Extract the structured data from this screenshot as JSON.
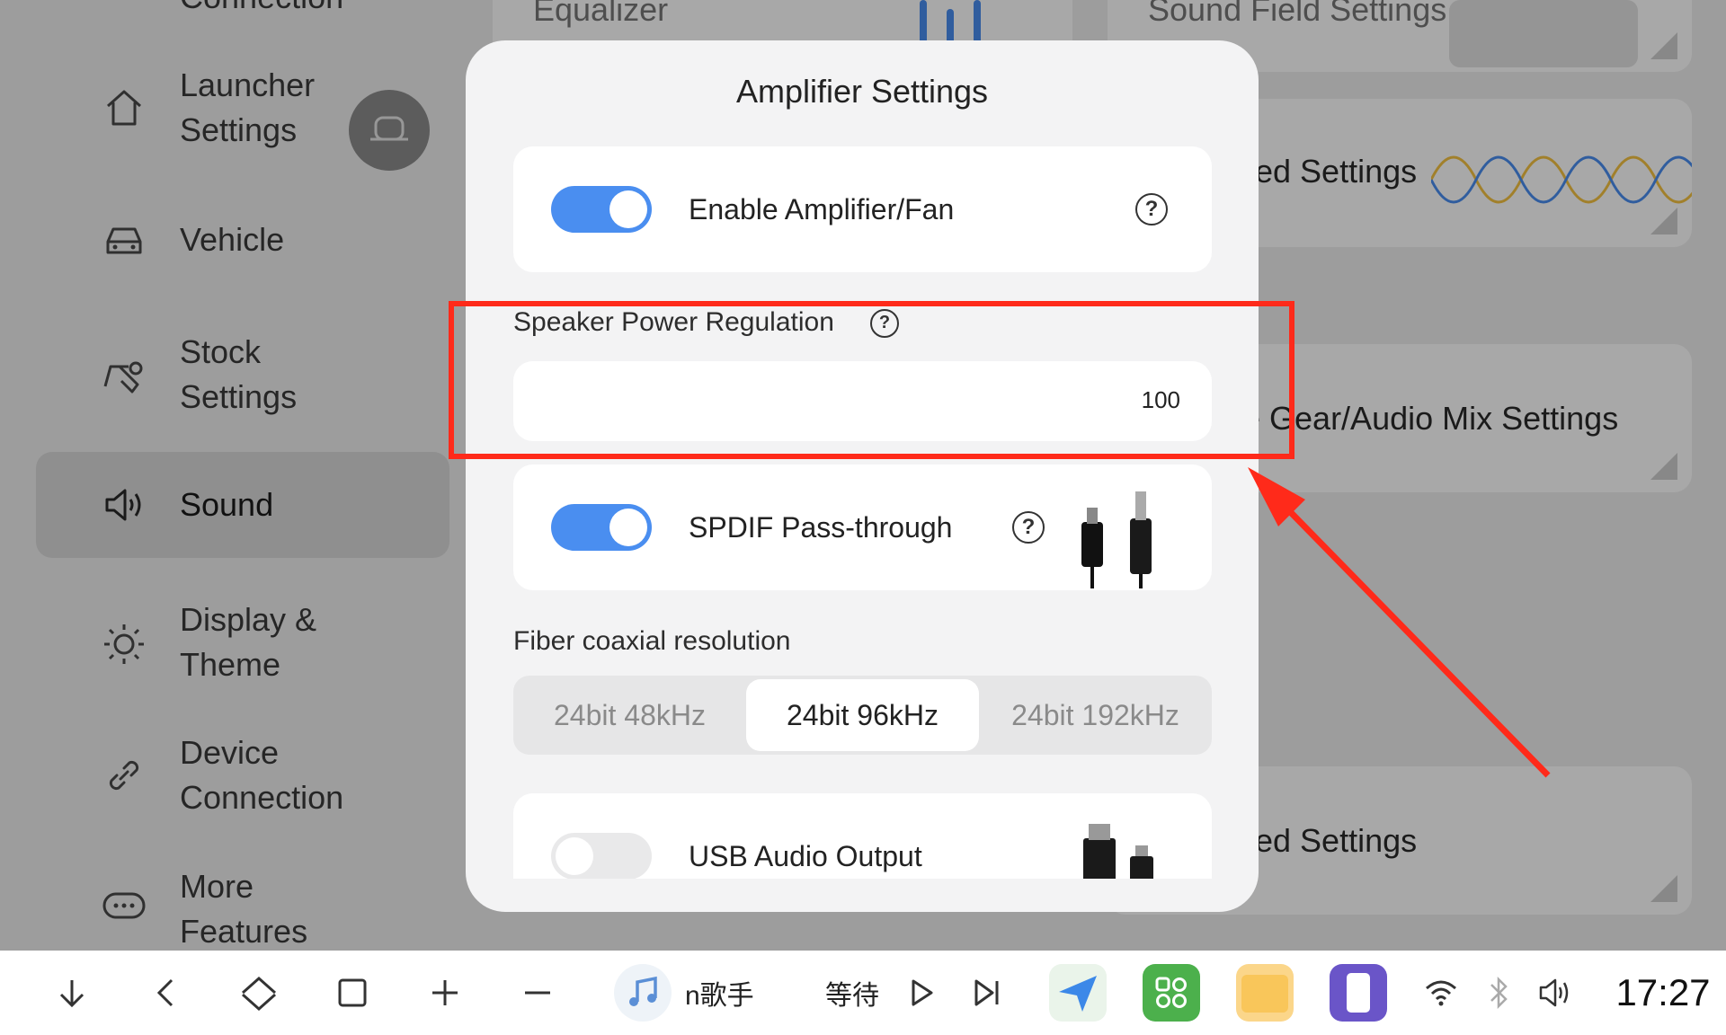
{
  "sidebar": {
    "items": [
      {
        "label": "Connection",
        "icon": "link-icon",
        "active": false
      },
      {
        "label": "Launcher\nSettings",
        "icon": "home-icon",
        "active": false
      },
      {
        "label": "Vehicle",
        "icon": "car-icon",
        "active": false
      },
      {
        "label": "Stock\nSettings",
        "icon": "steering-hand-icon",
        "active": false
      },
      {
        "label": "Sound",
        "icon": "speaker-icon",
        "active": true
      },
      {
        "label": "Display &\nTheme",
        "icon": "brightness-icon",
        "active": false
      },
      {
        "label": "Device\nConnection",
        "icon": "link-icon",
        "active": false
      },
      {
        "label": "More\nFeatures",
        "icon": "more-icon",
        "active": false
      }
    ]
  },
  "background_cards": {
    "equalizer": "Equalizer",
    "sound_field": "Sound Field Settings",
    "advanced_1": "ed Settings",
    "reverse_gear": "e Gear/Audio Mix Settings",
    "advanced_2": "ed Settings"
  },
  "modal": {
    "title": "Amplifier Settings",
    "enable_amplifier": {
      "label": "Enable Amplifier/Fan",
      "enabled": true
    },
    "speaker_power": {
      "label": "Speaker Power Regulation",
      "value": "100"
    },
    "spdif": {
      "label": "SPDIF Pass-through",
      "enabled": true
    },
    "fiber_resolution": {
      "label": "Fiber coaxial resolution",
      "options": [
        "24bit 48kHz",
        "24bit 96kHz",
        "24bit 192kHz"
      ],
      "selected": "24bit 96kHz"
    },
    "usb_audio": {
      "label": "USB Audio Output",
      "enabled": false
    }
  },
  "taskbar": {
    "music_left": "n歌手",
    "music_right": "等待",
    "time": "17:27"
  },
  "colors": {
    "accent": "#4a8ef0",
    "annotation": "#ff2a1a"
  }
}
